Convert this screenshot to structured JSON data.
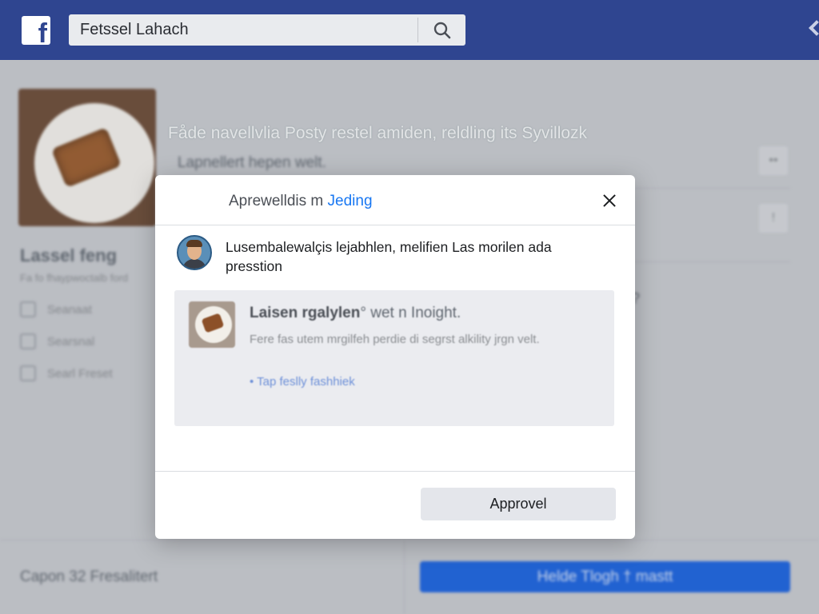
{
  "topbar": {
    "logo_icon": "facebook-logo-icon",
    "search_value": "Fetssel Lahach",
    "search_icon": "search-icon",
    "menu_icon": "chevron-down-icon"
  },
  "background": {
    "left": {
      "title": "Lassel feng",
      "subtitle": "Fa fo fhaypwoctalb ford",
      "items": [
        {
          "icon": "square-icon",
          "label": "Seanaat"
        },
        {
          "icon": "square-icon",
          "label": "Searsnal"
        },
        {
          "icon": "square-icon",
          "label": "Searl Freset"
        }
      ]
    },
    "post": {
      "title": "Fåde navellvlia Posty restel amiden, reldling its Syvillozk",
      "subtitle": "Lapnellert hepen welt."
    },
    "right": {
      "btn_top": "••",
      "btn_mid": "!",
      "mark": "?"
    },
    "bottom": {
      "left_text": "Capon 32 Fresalitert",
      "button_label": "Helde Tlogh † mastt"
    }
  },
  "modal": {
    "title_prefix": "Aprewelldis m ",
    "title_link": "Jeding",
    "close_icon": "close-icon",
    "avatar_icon": "user-avatar",
    "message": "Lusembalewalçis lejabhlen, melifien Las morilen ada presstion",
    "preview": {
      "title_bold": "Laisen rgalylen",
      "title_rest": "° wet n Inoight.",
      "description": "Fere fas utem mrgilfeh perdie di segrst alkility jrgn velt.",
      "link": "• Tap feslly fashhiek"
    },
    "approve_label": "Approvel"
  }
}
